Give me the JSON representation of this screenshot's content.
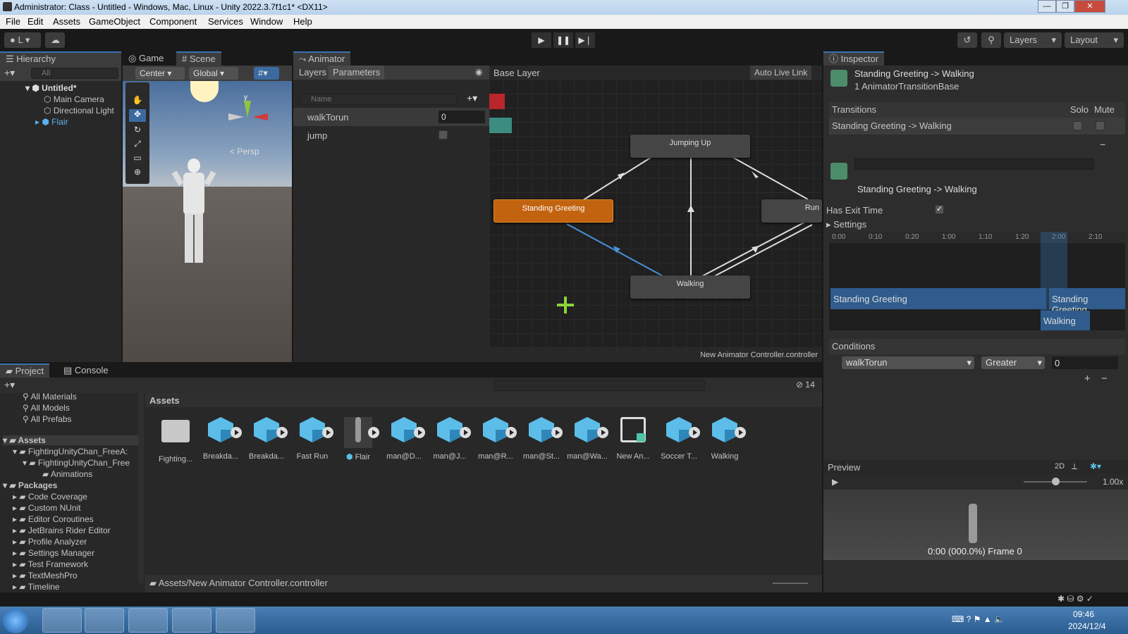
{
  "window": {
    "title": "Administrator: Class - Untitled - Windows, Mac, Linux - Unity 2022.3.7f1c1* <DX11>",
    "min": "—",
    "max": "❐",
    "close": "✕"
  },
  "menu": [
    "File",
    "Edit",
    "Assets",
    "GameObject",
    "Component",
    "Services",
    "Window",
    "Help"
  ],
  "toolbar": {
    "account": "L ▾",
    "layers": "Layers",
    "layout": "Layout"
  },
  "hierarchy": {
    "tab": "Hierarchy",
    "search": "All",
    "scene": "Untitled*",
    "items": [
      "Main Camera",
      "Directional Light",
      "Flair"
    ]
  },
  "scene_panel": {
    "tab_game": "Game",
    "tab_scene": "Scene",
    "pivot": "Center",
    "space": "Global",
    "persp": "< Persp",
    "axis_y": "y"
  },
  "animator": {
    "tab": "Animator",
    "tab_layers": "Layers",
    "tab_parameters": "Parameters",
    "param_search": "Name",
    "params": [
      {
        "name": "walkTorun",
        "value": "0"
      },
      {
        "name": "jump",
        "value": ""
      }
    ],
    "breadcrumb": "Base Layer",
    "auto_live": "Auto Live Link",
    "states": {
      "jump": "Jumping Up",
      "greet": "Standing Greeting",
      "walk": "Walking",
      "run": "Run"
    },
    "footer": "New Animator Controller.controller"
  },
  "inspector": {
    "tab": "Inspector",
    "title": "Standing Greeting -> Walking",
    "subtitle": "1 AnimatorTransitionBase",
    "transitions_label": "Transitions",
    "solo": "Solo",
    "mute": "Mute",
    "transition_row": "Standing Greeting -> Walking",
    "transition_name": "Standing Greeting -> Walking",
    "has_exit_time": "Has Exit Time",
    "has_exit_time_checked": "✓",
    "settings": "Settings",
    "timeline_ticks": [
      "0:00",
      "0:10",
      "0:20",
      "1:00",
      "1:10",
      "1:20",
      "2:00",
      "2:10"
    ],
    "clip_a": "Standing Greeting",
    "clip_a2": "Standing Greeting",
    "clip_b": "Walking",
    "conditions": "Conditions",
    "cond_param": "walkTorun",
    "cond_op": "Greater",
    "cond_value": "0",
    "preview": "Preview",
    "preview_2d": "2D",
    "preview_speed": "1.00x",
    "preview_frame": "0:00 (000.0%) Frame 0"
  },
  "project": {
    "tab_project": "Project",
    "tab_console": "Console",
    "favorites": [
      "All Materials",
      "All Models",
      "All Prefabs"
    ],
    "assets_root": "Assets",
    "asset_tree": [
      "FightingUnityChan_FreeA:",
      "FightingUnityChan_Free",
      "Animations"
    ],
    "packages_root": "Packages",
    "packages": [
      "Code Coverage",
      "Custom NUnit",
      "Editor Coroutines",
      "JetBrains Rider Editor",
      "Profile Analyzer",
      "Settings Manager",
      "Test Framework",
      "TextMeshPro",
      "Timeline"
    ],
    "header": "Assets",
    "hidden_count": "14",
    "assets": [
      "Fighting...",
      "Breakda...",
      "Breakda...",
      "Fast Run",
      "Flair",
      "man@D...",
      "man@J...",
      "man@R...",
      "man@St...",
      "man@Wa...",
      "New An...",
      "Soccer T...",
      "Walking"
    ],
    "path": "Assets/New Animator Controller.controller"
  },
  "taskbar": {
    "time": "09:46",
    "date": "2024/12/4"
  },
  "colors": {
    "accent": "#3a72b0",
    "state_orange": "#c2630f",
    "param_red": "#b8262b",
    "param_green": "#3d8c80"
  }
}
